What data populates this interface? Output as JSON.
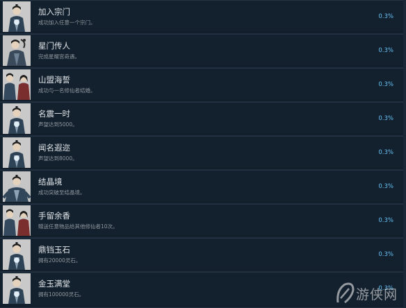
{
  "achievements": [
    {
      "title": "加入宗门",
      "desc": "成功加入任意一个宗门。",
      "percent": "0.3%",
      "icon": "cultivator-glow-icon"
    },
    {
      "title": "星门传人",
      "desc": "完成星耀宫奇遇。",
      "percent": "0.3%",
      "icon": "cultivator-star-icon"
    },
    {
      "title": "山盟海誓",
      "desc": "成功与一名修仙者结婚。",
      "percent": "0.3%",
      "icon": "couple-icon"
    },
    {
      "title": "名震一时",
      "desc": "声望达到5000。",
      "percent": "0.3%",
      "icon": "cultivator-glow-icon"
    },
    {
      "title": "闻名遐迩",
      "desc": "声望达到8000。",
      "percent": "0.3%",
      "icon": "cultivator-glow-icon"
    },
    {
      "title": "结晶境",
      "desc": "成功突破至结晶境。",
      "percent": "0.3%",
      "icon": "cultivator-meditate-icon"
    },
    {
      "title": "手留余香",
      "desc": "赠送任意物品给其他修仙者10次。",
      "percent": "0.3%",
      "icon": "couple-icon"
    },
    {
      "title": "鼎铛玉石",
      "desc": "拥有20000灵石。",
      "percent": "0.3%",
      "icon": "cultivator-glow-icon"
    },
    {
      "title": "金玉满堂",
      "desc": "拥有100000灵石。",
      "percent": "0.3%",
      "icon": "cultivator-glow-icon"
    }
  ],
  "watermark": {
    "text": "游侠网"
  }
}
